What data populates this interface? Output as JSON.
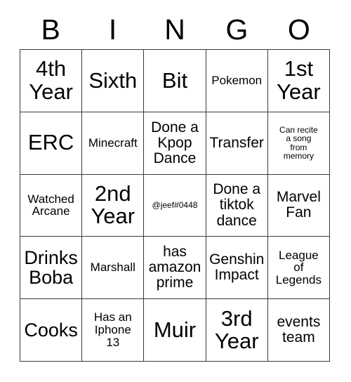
{
  "card": {
    "title_letters": [
      "B",
      "I",
      "N",
      "G",
      "O"
    ],
    "colors": {
      "background": "#ffffff",
      "text": "#000000",
      "grid_line": "#3a3a3a"
    },
    "grid": {
      "rows": 5,
      "columns": 5,
      "cells": [
        {
          "text": "4th\nYear",
          "size": "xl"
        },
        {
          "text": "Sixth",
          "size": "xl"
        },
        {
          "text": "Bit",
          "size": "xl"
        },
        {
          "text": "Pokemon",
          "size": "sm"
        },
        {
          "text": "1st\nYear",
          "size": "xl"
        },
        {
          "text": "ERC",
          "size": "xl"
        },
        {
          "text": "Minecraft",
          "size": "sm"
        },
        {
          "text": "Done a\nKpop\nDance",
          "size": "md"
        },
        {
          "text": "Transfer",
          "size": "md"
        },
        {
          "text": "Can recite\na song\nfrom\nmemory",
          "size": "xxs"
        },
        {
          "text": "Watched\nArcane",
          "size": "sm"
        },
        {
          "text": "2nd\nYear",
          "size": "xl"
        },
        {
          "text": "@jeef#0448",
          "size": "xxs"
        },
        {
          "text": "Done a\ntiktok\ndance",
          "size": "md"
        },
        {
          "text": "Marvel\nFan",
          "size": "md"
        },
        {
          "text": "Drinks\nBoba",
          "size": "lg"
        },
        {
          "text": "Marshall",
          "size": "sm"
        },
        {
          "text": "has\namazon\nprime",
          "size": "md"
        },
        {
          "text": "Genshin\nImpact",
          "size": "md"
        },
        {
          "text": "League\nof\nLegends",
          "size": "sm"
        },
        {
          "text": "Cooks",
          "size": "lg"
        },
        {
          "text": "Has an\nIphone\n13",
          "size": "sm"
        },
        {
          "text": "Muir",
          "size": "xl"
        },
        {
          "text": "3rd\nYear",
          "size": "xl"
        },
        {
          "text": "events\nteam",
          "size": "md"
        }
      ]
    }
  }
}
